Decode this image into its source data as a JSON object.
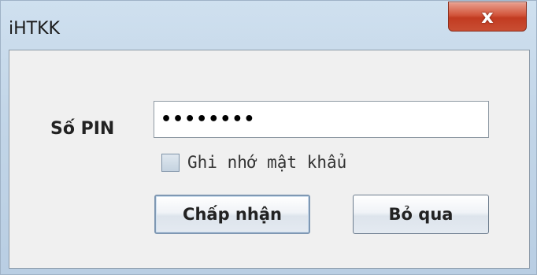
{
  "window": {
    "title": "iHTKK"
  },
  "titlebar": {
    "close_icon": "close-icon",
    "close_glyph": "x"
  },
  "form": {
    "pin_label": "Số PIN",
    "pin_value": "••••••••",
    "remember_label": "Ghi nhớ mật khẩu",
    "remember_checked": false
  },
  "buttons": {
    "accept_label": "Chấp nhận",
    "skip_label": "Bỏ qua"
  }
}
